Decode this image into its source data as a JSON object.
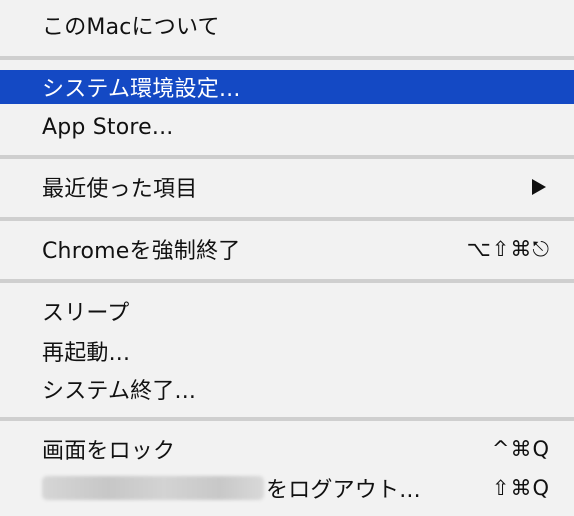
{
  "menu": {
    "about": "このMacについて",
    "system_prefs": "システム環境設定...",
    "app_store": "App Store...",
    "recent_items": "最近使った項目",
    "force_quit": "Chromeを強制終了",
    "force_quit_shortcut": "⌥⇧⌘⎋",
    "sleep": "スリープ",
    "restart": "再起動...",
    "shutdown": "システム終了...",
    "lock_screen": "画面をロック",
    "lock_screen_shortcut": "^⌘Q",
    "logout_suffix": "をログアウト...",
    "logout_shortcut": "⇧⌘Q"
  },
  "icons": {
    "submenu": "chevron-right-icon",
    "redacted": "redacted-username"
  },
  "colors": {
    "menu_background": "#f2f2f2",
    "selection": "#1449c4",
    "separator": "#cfcfcf",
    "text": "#111111"
  }
}
